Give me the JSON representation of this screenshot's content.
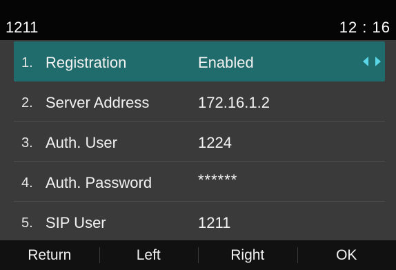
{
  "status": {
    "account": "1211",
    "time": "12 : 16"
  },
  "rows": [
    {
      "num": "1.",
      "label": "Registration",
      "value": "Enabled"
    },
    {
      "num": "2.",
      "label": "Server Address",
      "value": "172.16.1.2"
    },
    {
      "num": "3.",
      "label": "Auth. User",
      "value": "1224"
    },
    {
      "num": "4.",
      "label": "Auth. Password",
      "value": "******"
    },
    {
      "num": "5.",
      "label": "SIP User",
      "value": "1211"
    }
  ],
  "softkeys": {
    "return": "Return",
    "left": "Left",
    "right": "Right",
    "ok": "OK"
  },
  "colors": {
    "selected_row": "#206b6b",
    "arrow": "#5ad6e6",
    "background": "#3a3a3a"
  },
  "icons": {
    "selector": "left-right-arrows-icon"
  }
}
